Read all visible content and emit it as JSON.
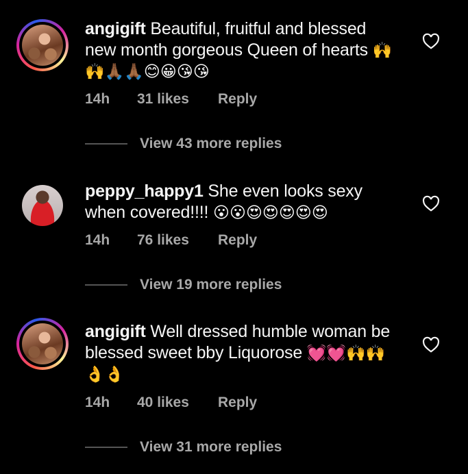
{
  "comments": [
    {
      "username": "angigift",
      "text": " Beautiful, fruitful and blessed new month gorgeous Queen of hearts ",
      "emojis": "🙌🙌🙏🏾🙏🏾😊😀😘😘",
      "time": "14h",
      "likes": "31 likes",
      "reply": "Reply",
      "view_replies": "View 43 more replies"
    },
    {
      "username": "peppy_happy1",
      "text": " She even looks sexy when covered!!!! ",
      "emojis": "😮😮😍😍😍😍😍",
      "time": "14h",
      "likes": "76 likes",
      "reply": "Reply",
      "view_replies": "View 19 more replies"
    },
    {
      "username": "angigift",
      "text": " Well dressed humble woman be blessed sweet bby Liquorose ",
      "emojis": "💓💓🙌🙌👌👌",
      "time": "14h",
      "likes": "40 likes",
      "reply": "Reply",
      "view_replies": "View 31 more replies"
    }
  ]
}
